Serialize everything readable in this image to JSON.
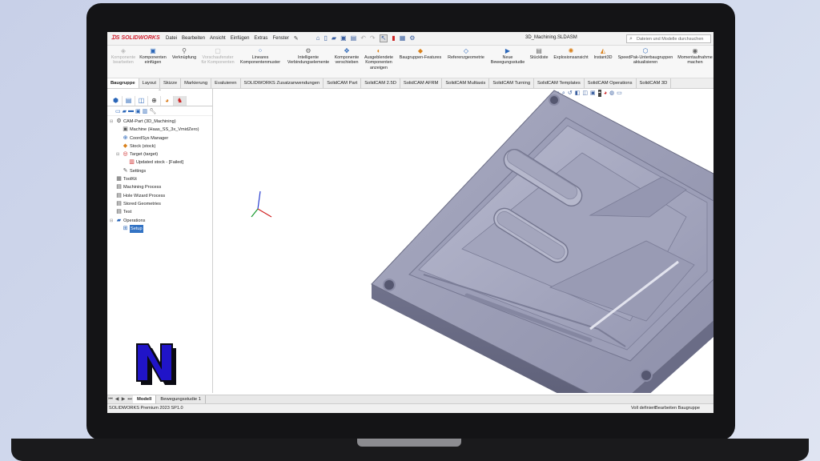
{
  "app": {
    "logo": "SOLIDWORKS",
    "menus": [
      "Datei",
      "Bearbeiten",
      "Ansicht",
      "Einfügen",
      "Extras",
      "Fenster"
    ],
    "document_title": "3D_Machining.SLDASM",
    "search_placeholder": "Dateien und Modelle durchsuchen"
  },
  "ribbon": {
    "buttons": [
      {
        "label": "Komponente bearbeiten",
        "icon": "edit-component-icon",
        "disabled": true
      },
      {
        "label": "Komponenten einfügen",
        "icon": "insert-components-icon",
        "disabled": false
      },
      {
        "label": "Verknüpfung",
        "icon": "mate-icon",
        "disabled": false
      },
      {
        "label": "Vorschaufenster für Komponenten",
        "icon": "preview-window-icon",
        "disabled": true
      },
      {
        "label": "Lineares Komponentenmuster",
        "icon": "linear-pattern-icon",
        "disabled": false
      },
      {
        "label": "Intelligente Verbindungselemente",
        "icon": "smart-fasteners-icon",
        "disabled": false
      },
      {
        "label": "Komponente verschieben",
        "icon": "move-component-icon",
        "disabled": false
      },
      {
        "label": "Ausgeblendete Komponenten anzeigen",
        "icon": "show-hidden-icon",
        "disabled": false
      },
      {
        "label": "Baugruppen-Features",
        "icon": "assembly-features-icon",
        "disabled": false
      },
      {
        "label": "Referenzgeometrie",
        "icon": "reference-geometry-icon",
        "disabled": false
      },
      {
        "label": "Neue Bewegungsstudie",
        "icon": "motion-study-icon",
        "disabled": false
      },
      {
        "label": "Stückliste",
        "icon": "bom-icon",
        "disabled": false
      },
      {
        "label": "Explosionsansicht",
        "icon": "exploded-view-icon",
        "disabled": false
      },
      {
        "label": "Instant3D",
        "icon": "instant3d-icon",
        "disabled": false
      },
      {
        "label": "SpeedPak-Unterbaugruppen aktualisieren",
        "icon": "speedpak-icon",
        "disabled": false
      },
      {
        "label": "Momentaufnahme machen",
        "icon": "snapshot-icon",
        "disabled": false
      }
    ]
  },
  "command_tabs": [
    "Baugruppe",
    "Layout",
    "Skizze",
    "Markierung",
    "Evaluieren",
    "SOLIDWORKS Zusatzanwendungen",
    "SolidCAM Part",
    "SolidCAM 2.5D",
    "SolidCAM AFRM",
    "SolidCAM Multiaxis",
    "SolidCAM Turning",
    "SolidCAM Templates",
    "SolidCAM Operations",
    "SolidCAM 3D"
  ],
  "active_tab": "Baugruppe",
  "tree": [
    {
      "label": "CAM-Part (3D_Machining)",
      "level": 0,
      "icon": "cam-part-icon",
      "expander": "minus"
    },
    {
      "label": "Machine (Haas_SS_3x_VmidZero)",
      "level": 1,
      "icon": "machine-icon",
      "expander": ""
    },
    {
      "label": "CoordSys Manager",
      "level": 1,
      "icon": "coordsys-icon",
      "expander": ""
    },
    {
      "label": "Stock (stock)",
      "level": 1,
      "icon": "stock-icon",
      "expander": ""
    },
    {
      "label": "Target (target)",
      "level": 1,
      "icon": "target-icon",
      "expander": "minus"
    },
    {
      "label": "Updated stock - [Failed]",
      "level": 2,
      "icon": "updated-stock-icon",
      "expander": ""
    },
    {
      "label": "Settings",
      "level": 1,
      "icon": "settings-icon",
      "expander": ""
    },
    {
      "label": "ToolKit",
      "level": 0,
      "icon": "toolkit-icon",
      "expander": ""
    },
    {
      "label": "Machining Process",
      "level": 0,
      "icon": "machining-process-icon",
      "expander": ""
    },
    {
      "label": "Hole Wizard Process",
      "level": 0,
      "icon": "hole-wizard-icon",
      "expander": ""
    },
    {
      "label": "Stored Geometries",
      "level": 0,
      "icon": "stored-geometries-icon",
      "expander": ""
    },
    {
      "label": "Test",
      "level": 0,
      "icon": "test-icon",
      "expander": ""
    },
    {
      "label": "Operations",
      "level": 0,
      "icon": "operations-folder-icon",
      "expander": "minus"
    },
    {
      "label": "Setup",
      "level": 1,
      "icon": "setup-icon",
      "expander": "",
      "selected": true
    }
  ],
  "bottom_tabs": [
    "Modell",
    "Bewegungsstudie 1"
  ],
  "status": {
    "version": "SOLIDWORKS Premium 2023 SP1.0",
    "state": "Voll definiert",
    "mode": "Bearbeiten Baugruppe"
  },
  "colors": {
    "brand_red": "#d2202f",
    "selection_blue": "#3373c4",
    "part_gray": "#9a9cb3",
    "n_logo_blue": "#2014c8"
  }
}
